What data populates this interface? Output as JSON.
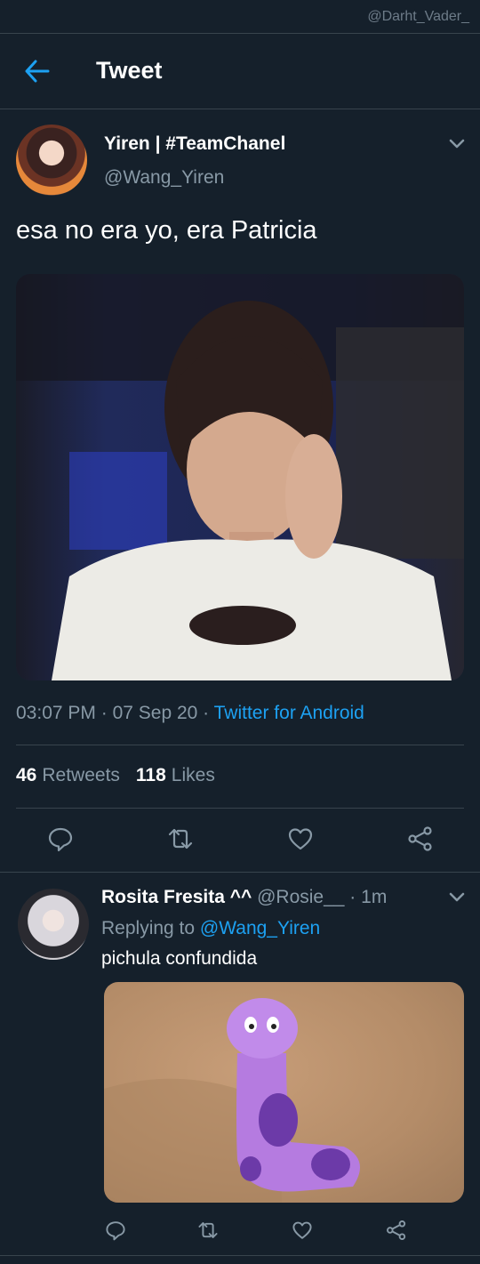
{
  "watermark": "@Darht_Vader_",
  "header": {
    "title": "Tweet",
    "back_icon": "arrow-left-icon"
  },
  "colors": {
    "background": "#15202b",
    "accent": "#1da1f2",
    "muted": "#8899a6",
    "divider": "#38444d"
  },
  "tweet": {
    "author_name": "Yiren | #TeamChanel",
    "author_handle": "@Wang_Yiren",
    "text": "esa no era yo, era Patricia",
    "time": "03:07 PM",
    "date": "07 Sep 20",
    "source": "Twitter for Android",
    "retweets_count": "46",
    "retweets_label": "Retweets",
    "likes_count": "118",
    "likes_label": "Likes",
    "actions": [
      "reply-icon",
      "retweet-icon",
      "like-icon",
      "share-icon"
    ]
  },
  "reply": {
    "author_name": "Rosita Fresita ^^",
    "author_handle": "@Rosie__",
    "time_ago": "1m",
    "replying_label": "Replying to",
    "replying_to": "@Wang_Yiren",
    "text": "pichula confundida"
  }
}
